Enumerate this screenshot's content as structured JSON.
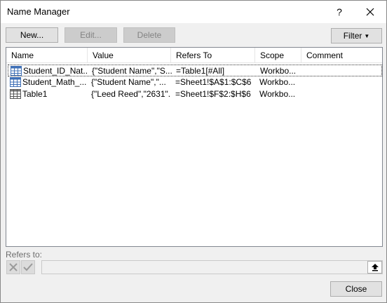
{
  "window": {
    "title": "Name Manager",
    "help_label": "?"
  },
  "toolbar": {
    "new_label": "New...",
    "edit_label": "Edit...",
    "delete_label": "Delete",
    "filter_label": "Filter"
  },
  "columns": [
    "Name",
    "Value",
    "Refers To",
    "Scope",
    "Comment"
  ],
  "rows": [
    {
      "name": "Student_ID_Nat...",
      "value": "{\"Student Name\",\"S...",
      "refers_to": "=Table1[#All]",
      "scope": "Workbo...",
      "comment": "",
      "icon": "table-icon",
      "selected": true
    },
    {
      "name": "Student_Math_...",
      "value": "{\"Student Name\",\"...",
      "refers_to": "=Sheet1!$A$1:$C$6",
      "scope": "Workbo...",
      "comment": "",
      "icon": "table-icon",
      "selected": false
    },
    {
      "name": "Table1",
      "value": "{\"Leed Reed\",\"2631\"...",
      "refers_to": "=Sheet1!$F$2:$H$6",
      "scope": "Workbo...",
      "comment": "",
      "icon": "table-grid-icon",
      "selected": false
    }
  ],
  "refers_to": {
    "label": "Refers to:",
    "value": ""
  },
  "footer": {
    "close_label": "Close"
  },
  "colors": {
    "accent": "#0078d7",
    "table_icon_blue": "#3e6fb6"
  }
}
